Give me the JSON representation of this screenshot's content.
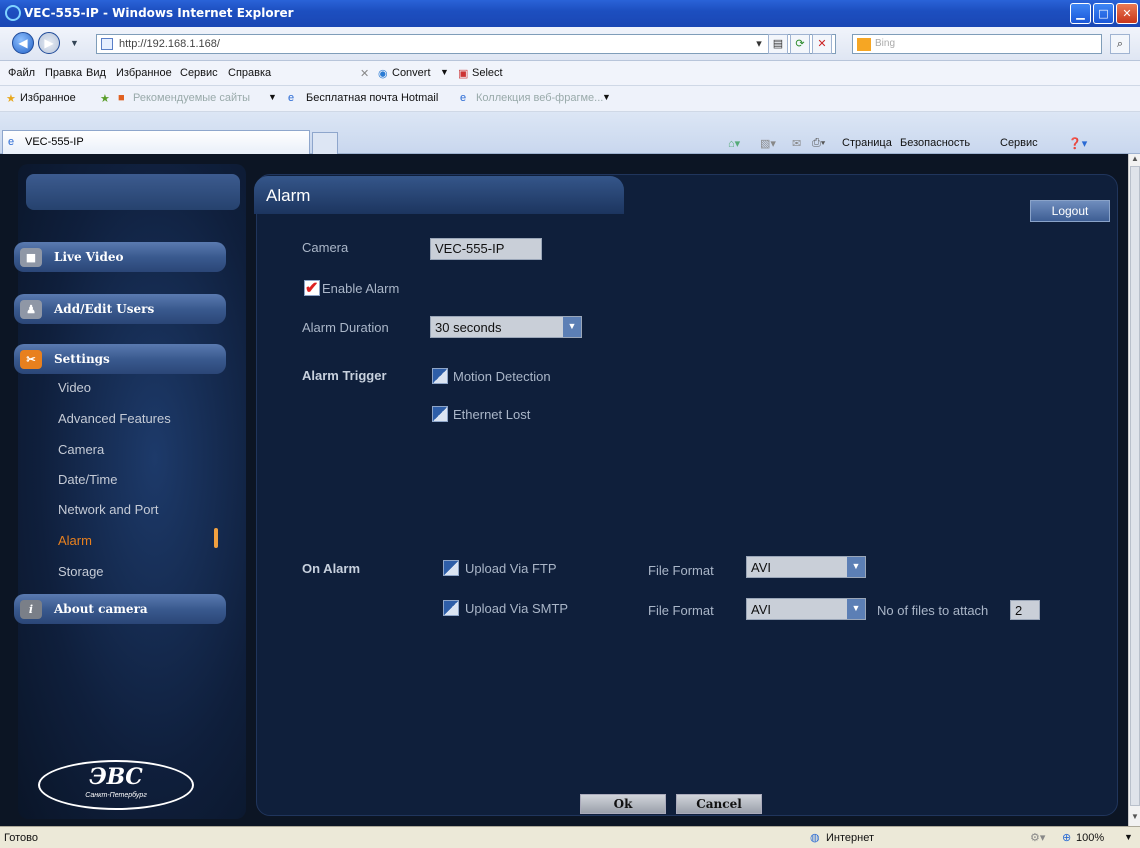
{
  "browser": {
    "title": "VEC-555-IP - Windows Internet Explorer",
    "url": "http://192.168.1.168/",
    "search_placeholder": "Bing",
    "menu": [
      "Файл",
      "Правка",
      "Вид",
      "Избранное",
      "Сервис",
      "Справка"
    ],
    "toolbar_extra": [
      "Convert",
      "Select"
    ],
    "favorites": [
      "Избранное",
      "Рекомендуемые сайты",
      "Бесплатная почта Hotmail",
      "Коллекция веб-фрагме..."
    ],
    "tab_title": "VEC-555-IP",
    "command_bar": [
      "Страница",
      "Безопасность",
      "Сервис"
    ],
    "status_text": "Готово",
    "zone": "Интернет",
    "zoom": "100%"
  },
  "sidebar": {
    "live_video": "Live Video",
    "add_edit_users": "Add/Edit Users",
    "settings": "Settings",
    "settings_items": [
      "Video",
      "Advanced Features",
      "Camera",
      "Date/Time",
      "Network and Port",
      "Alarm",
      "Storage"
    ],
    "active_item": "Alarm",
    "about": "About camera",
    "logo_text": "ЭВС",
    "logo_sub": "Санкт-Петербург"
  },
  "page": {
    "title": "Alarm",
    "logout": "Logout",
    "camera_label": "Camera",
    "camera_value": "VEC-555-IP",
    "enable_alarm": "Enable Alarm",
    "enable_alarm_checked": true,
    "duration_label": "Alarm Duration",
    "duration_value": "30 seconds",
    "trigger_label": "Alarm Trigger",
    "motion_detection": "Motion Detection",
    "ethernet_lost": "Ethernet Lost",
    "on_alarm_label": "On Alarm",
    "upload_ftp": "Upload Via FTP",
    "upload_smtp": "Upload Via SMTP",
    "file_format_label": "File Format",
    "ftp_format": "AVI",
    "smtp_format": "AVI",
    "files_attach_label": "No of files to attach",
    "files_attach_value": "2",
    "ok": "Ok",
    "cancel": "Cancel"
  }
}
